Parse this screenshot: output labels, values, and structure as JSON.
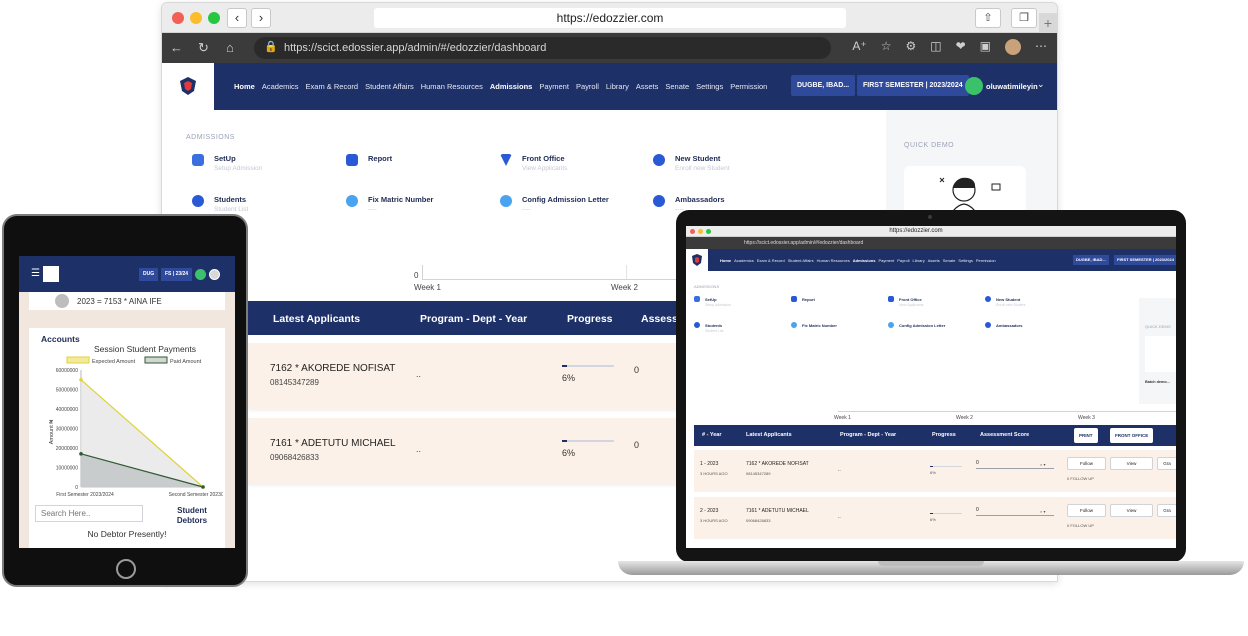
{
  "browser": {
    "mac_url": "https://edozzier.com",
    "edge_url": "https://scict.edossier.app/admin/#/edozzier/dashboard",
    "edge_url_host": "scict.edossier.app"
  },
  "nav": {
    "menu": [
      "Home",
      "Academics",
      "Exam & Record",
      "Student Affairs",
      "Human Resources",
      "Admissions",
      "Payment",
      "Payroll",
      "Library",
      "Assets",
      "Senate",
      "Settings",
      "Permission"
    ],
    "active": "Home",
    "campus": "DUGBE, IBAD...",
    "semester": "FIRST SEMESTER | 2023/2024",
    "user": "oluwatimileyin"
  },
  "admissions": {
    "title": "ADMISSIONS",
    "items": [
      {
        "label": "SetUp",
        "sub": "Setup Admission"
      },
      {
        "label": "Report",
        "sub": ""
      },
      {
        "label": "Front Office",
        "sub": "View Applicants"
      },
      {
        "label": "New Student",
        "sub": "Enroll new Student"
      },
      {
        "label": "Students",
        "sub": "Student List"
      },
      {
        "label": "Fix Matric Number",
        "sub": "----"
      },
      {
        "label": "Config Admission Letter",
        "sub": "----"
      },
      {
        "label": "Ambassadors",
        "sub": "----"
      }
    ],
    "quick_demo": "QUICK DEMO",
    "batch_demo": "Batch demo..."
  },
  "chart_axis": {
    "zero": "0",
    "weeks": [
      "Week 1",
      "Week 2",
      "Week 3"
    ]
  },
  "table": {
    "columns": [
      "# - Year",
      "Latest Applicants",
      "Program - Dept - Year",
      "Progress",
      "Assessment Score"
    ],
    "col_assess_short": "Assess",
    "buttons": [
      "PRINT",
      "FRONT OFFICE"
    ],
    "rows": [
      {
        "year": "1 - 2023",
        "ago": "3 HOURS AGO",
        "name": "7162 * AKOREDE NOFISAT",
        "phone": "08145347289",
        "program": "..",
        "progress_label": "6%",
        "progress": 0.06,
        "score": "0",
        "follow": "Follow",
        "view": "View",
        "followups": "0 FOLLOW UP",
        "more": "Gra"
      },
      {
        "year": "2 - 2023",
        "ago": "3 HOURS AGO",
        "name": "7161 * ADETUTU MICHAEL",
        "phone": "09068426833",
        "program": "..",
        "progress_label": "6%",
        "progress": 0.06,
        "score": "0",
        "follow": "Follow",
        "view": "View",
        "followups": "0 FOLLOW UP",
        "more": "Gra"
      }
    ]
  },
  "tablet": {
    "chip1": "DUG",
    "chip2": "FS | 23/24",
    "student_line": "2023 = 7153 * AINA IFE",
    "accounts": "Accounts",
    "search_placeholder": "Search Here..",
    "student_debtors": "Student Debtors",
    "no_debtor": "No Debtor Presently!"
  },
  "chart_data": {
    "type": "area",
    "title": "Session Student Payments",
    "xlabel": "",
    "ylabel": "Amount ₦",
    "categories": [
      "First Semester 2023/2024",
      "Second Semester 2023/2024"
    ],
    "series": [
      {
        "name": "Expected Amount",
        "values": [
          55000000,
          0
        ],
        "color": "#e0d23b"
      },
      {
        "name": "Paid Amount",
        "values": [
          17000000,
          0
        ],
        "color": "#2f5a34"
      }
    ],
    "yticks": [
      "0",
      "10000000",
      "20000000",
      "30000000",
      "40000000",
      "50000000",
      "60000000"
    ],
    "ylim": [
      0,
      60000000
    ],
    "legend": "top",
    "grid": false
  },
  "colors": {
    "navy": "#1e3068",
    "accent": "#2f4a9a",
    "row_bg": "#fbf1e8",
    "green": "#3ac26a"
  }
}
